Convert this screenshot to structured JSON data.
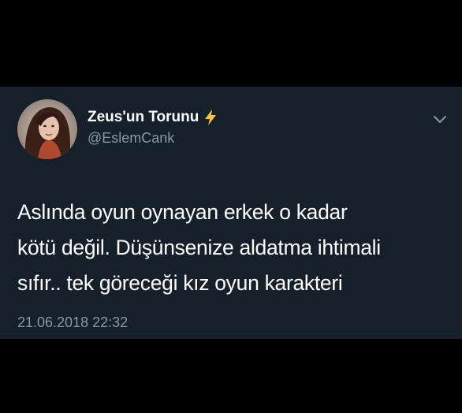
{
  "tweet": {
    "display_name": "Zeus'un Torunu",
    "badge_icon": "lightning-bolt-icon",
    "handle": "@EslemCank",
    "text_lines": [
      "Aslında oyun oynayan erkek o kadar",
      "kötü değil. Düşünsenize aldatma ihtimali",
      "sıfır.. tek göreceği kız oyun karakteri"
    ],
    "timestamp": "21.06.2018 22:32",
    "menu_icon": "chevron-down-icon"
  },
  "colors": {
    "page_background": "#000000",
    "card_background": "#15202b",
    "text_primary": "#ffffff",
    "text_secondary": "#8899a6",
    "bolt": "#f5c542"
  }
}
